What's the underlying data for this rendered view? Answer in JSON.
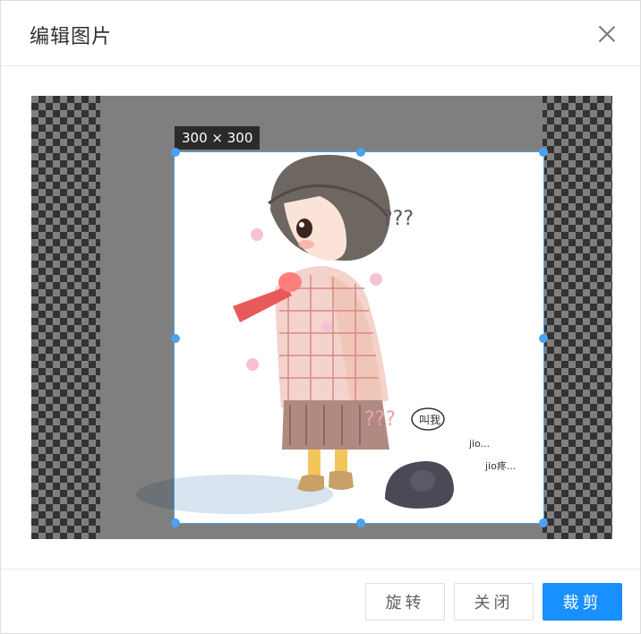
{
  "dialog": {
    "title": "编辑图片"
  },
  "cropper": {
    "size_label": "300 × 300",
    "qs_top": "???",
    "qs_mid": "???",
    "bubble": "叫我",
    "jio1": "jio...",
    "jio2": "jio疼..."
  },
  "buttons": {
    "rotate": "旋转",
    "close": "关闭",
    "crop": "裁剪"
  },
  "colors": {
    "primary": "#1890ff",
    "handle": "#4aa3f0"
  }
}
